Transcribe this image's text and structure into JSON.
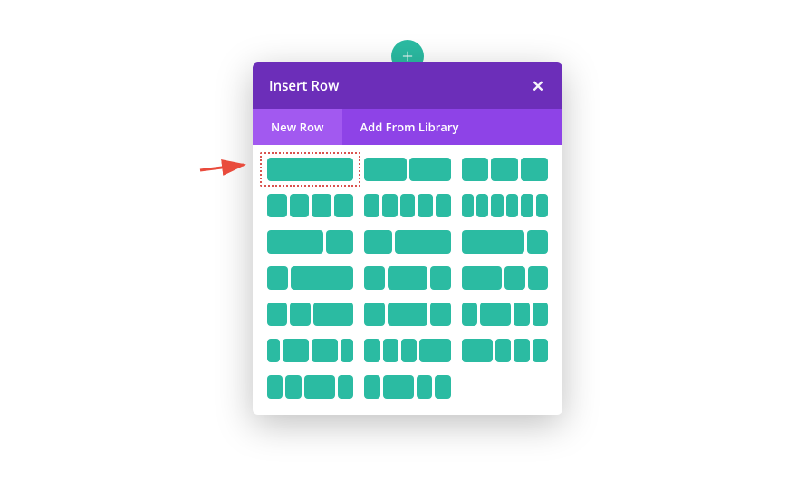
{
  "add_button": {
    "symbol": "+"
  },
  "modal": {
    "title": "Insert Row",
    "close_symbol": "✕",
    "tabs": {
      "new_row": "New Row",
      "add_from_library": "Add From Library",
      "active": "new_row"
    }
  },
  "layouts": [
    {
      "name": "1-col",
      "cols": [
        1
      ]
    },
    {
      "name": "2-col-1-1",
      "cols": [
        1,
        1
      ]
    },
    {
      "name": "3-col-1-1-1",
      "cols": [
        1,
        1,
        1
      ]
    },
    {
      "name": "4-col",
      "cols": [
        1,
        1,
        1,
        1
      ]
    },
    {
      "name": "5-col",
      "cols": [
        1,
        1,
        1,
        1,
        1
      ]
    },
    {
      "name": "6-col",
      "cols": [
        1,
        1,
        1,
        1,
        1,
        1
      ]
    },
    {
      "name": "2-col-2-3-1-3",
      "cols": [
        2,
        1
      ]
    },
    {
      "name": "2-col-1-3-2-3",
      "cols": [
        1,
        2
      ]
    },
    {
      "name": "2-col-3-4-1-4",
      "cols": [
        3,
        1
      ]
    },
    {
      "name": "2-col-1-4-3-4",
      "cols": [
        1,
        3
      ]
    },
    {
      "name": "3-col-1-2-1",
      "cols": [
        1,
        2,
        1
      ]
    },
    {
      "name": "3-col-2-1-1",
      "cols": [
        2,
        1,
        1
      ]
    },
    {
      "name": "3-col-1-1-2",
      "cols": [
        1,
        1,
        2
      ]
    },
    {
      "name": "3-col-1-4-1-2-1-4",
      "cols": [
        1,
        2,
        1
      ]
    },
    {
      "name": "4-col-1-2-1-1",
      "cols": [
        1,
        2,
        1,
        1
      ]
    },
    {
      "name": "4-col-1-2-2-1",
      "cols": [
        1,
        2,
        2,
        1
      ]
    },
    {
      "name": "4-col-1-1-1-2",
      "cols": [
        1,
        1,
        1,
        2
      ]
    },
    {
      "name": "4-col-2-1-1-1",
      "cols": [
        2,
        1,
        1,
        1
      ]
    },
    {
      "name": "4-col-1-1-2-1",
      "cols": [
        1,
        1,
        2,
        1
      ]
    },
    {
      "name": "4-col-1-2-1-1b",
      "cols": [
        1,
        2,
        1,
        1
      ]
    }
  ],
  "highlight_index": 0,
  "colors": {
    "teal": "#2bbba2",
    "purple_dark": "#6c2eb9",
    "purple_light": "#8e43e7",
    "purple_active": "#a259f0",
    "red": "#d9534f"
  }
}
